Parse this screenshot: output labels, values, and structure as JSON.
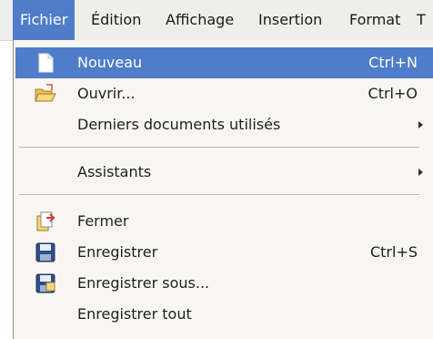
{
  "menubar": {
    "items": [
      {
        "label": "Fichier",
        "active": true
      },
      {
        "label": "Édition"
      },
      {
        "label": "Affichage"
      },
      {
        "label": "Insertion"
      },
      {
        "label": "Format"
      },
      {
        "label": "T"
      }
    ]
  },
  "menu": {
    "items": [
      {
        "label": "Nouveau",
        "shortcut": "Ctrl+N",
        "icon": "new-document-icon",
        "highlighted": true
      },
      {
        "label": "Ouvrir...",
        "shortcut": "Ctrl+O",
        "icon": "open-folder-icon"
      },
      {
        "label": "Derniers documents utilisés",
        "submenu": true
      },
      {
        "label": "Assistants",
        "submenu": true
      },
      {
        "label": "Fermer",
        "icon": "close-document-icon"
      },
      {
        "label": "Enregistrer",
        "shortcut": "Ctrl+S",
        "icon": "save-icon"
      },
      {
        "label": "Enregistrer sous...",
        "icon": "save-as-icon"
      },
      {
        "label": "Enregistrer tout"
      }
    ]
  },
  "colors": {
    "highlight": "#4f7dc9",
    "menu_background": "#f7f6f2",
    "menubar_background": "#eeeeea"
  }
}
